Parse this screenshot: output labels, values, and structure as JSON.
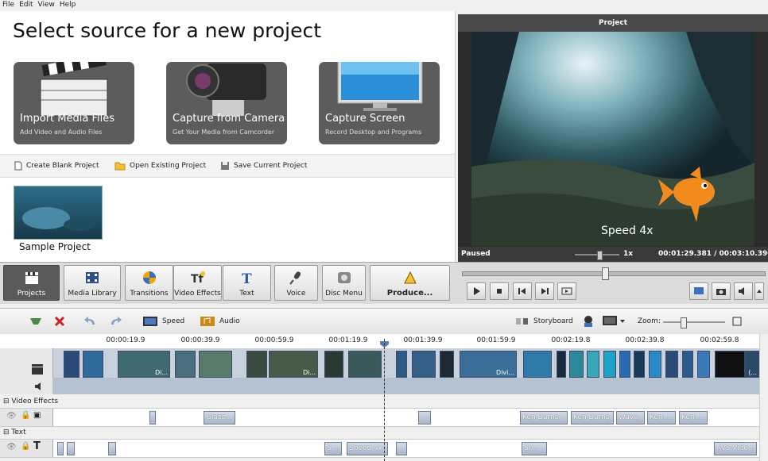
{
  "menu": [
    "File",
    "Edit",
    "View",
    "Help"
  ],
  "start": {
    "title": "Select source for a new project",
    "tiles": [
      {
        "title": "Import Media Files",
        "subtitle": "Add Video and Audio Files"
      },
      {
        "title": "Capture from Camera",
        "subtitle": "Get Your Media from Camcorder"
      },
      {
        "title": "Capture Screen",
        "subtitle": "Record Desktop and Programs"
      }
    ],
    "actions": [
      "Create Blank Project",
      "Open Existing Project",
      "Save Current Project"
    ],
    "sample_label": "Sample Project"
  },
  "preview": {
    "header": "Project",
    "overlay_text": "Speed 4x",
    "status": "Paused",
    "speed": "1x",
    "timecode": "00:01:29.381 / 00:03:10.390",
    "volume_level": 0.55,
    "position_fraction": 0.47
  },
  "toolbar": [
    {
      "label": "Projects",
      "icon": "clapperboard-icon"
    },
    {
      "label": "Media Library",
      "icon": "film-icon"
    },
    {
      "label": "Transitions",
      "icon": "transitions-icon"
    },
    {
      "label": "Video Effects",
      "icon": "video-effects-icon"
    },
    {
      "label": "Text",
      "icon": "text-icon"
    },
    {
      "label": "Voice",
      "icon": "microphone-icon"
    },
    {
      "label": "Disc Menu",
      "icon": "disc-icon"
    },
    {
      "label": "Produce...",
      "icon": "produce-icon"
    }
  ],
  "timeline_toolbar": {
    "speed": "Speed",
    "audio": "Audio",
    "storyboard": "Storyboard",
    "zoom": "Zoom:"
  },
  "ruler": [
    "00:00:19.9",
    "00:00:39.9",
    "00:00:59.9",
    "00:01:19.9",
    "00:01:39.9",
    "00:01:59.9",
    "00:02:19.8",
    "00:02:39.8",
    "00:02:59.8"
  ],
  "clip_labels": [
    "Di...",
    "Di...",
    "Divi...",
    "(..."
  ],
  "sections": {
    "video_effects": "Video Effects",
    "text": "Text"
  },
  "effects": [
    "Glass...",
    "Ken Burns",
    "Ken Burns",
    "Wave",
    "Ken ...",
    "Ken ..."
  ],
  "texts": [
    "S...",
    "Speed 4x",
    "So...",
    "AVS Vide..."
  ]
}
